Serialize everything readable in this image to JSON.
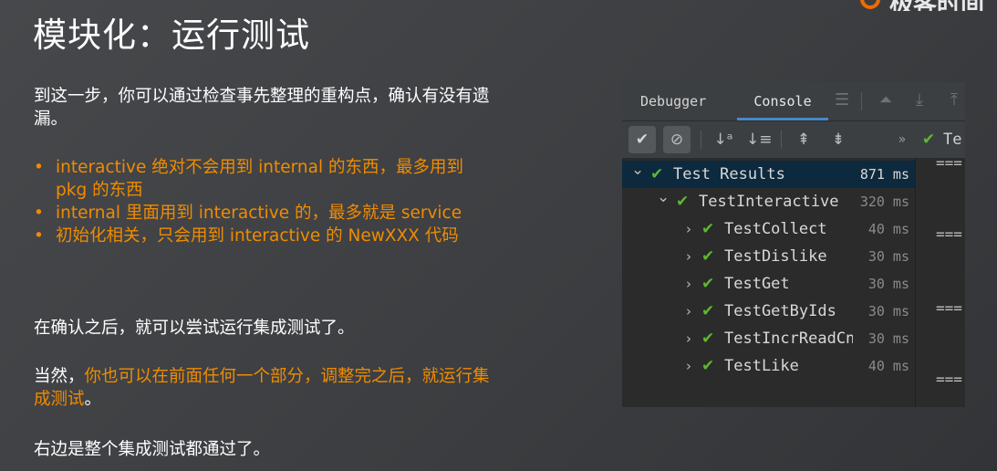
{
  "slide": {
    "title": "模块化：运行测试",
    "logo_text": "极客时间"
  },
  "content": {
    "intro": "到这一步，你可以通过检查事先整理的重构点，确认有没有遗漏。",
    "points": [
      "interactive 绝对不会用到 internal 的东西，最多用到 pkg 的东西",
      "internal 里面用到 interactive 的，最多就是 service",
      "初始化相关，只会用到 interactive 的 NewXXX 代码"
    ],
    "after_confirm": "在确认之后，就可以尝试运行集成测试了。",
    "also_prefix": "当然，",
    "also_highlight": "你也可以在前面任何一个部分，调整完之后，就运行集成测试",
    "also_suffix": "。",
    "right_side": "右边是整个集成测试都通过了。"
  },
  "ide": {
    "tabs": [
      "Debugger",
      "Console"
    ],
    "active_tab": "Console",
    "toolbar_truncated_label": "Te",
    "tree": [
      {
        "label": "Test Results",
        "time": "871 ms",
        "level": 0,
        "expanded": true,
        "selected": true
      },
      {
        "label": "TestInteractive",
        "time": "320 ms",
        "level": 1,
        "expanded": true,
        "selected": false
      },
      {
        "label": "TestCollect",
        "time": "40 ms",
        "level": 2,
        "expanded": false,
        "selected": false
      },
      {
        "label": "TestDislike",
        "time": "30 ms",
        "level": 2,
        "expanded": false,
        "selected": false
      },
      {
        "label": "TestGet",
        "time": "30 ms",
        "level": 2,
        "expanded": false,
        "selected": false
      },
      {
        "label": "TestGetByIds",
        "time": "30 ms",
        "level": 2,
        "expanded": false,
        "selected": false
      },
      {
        "label": "TestIncrReadCnt",
        "time": "30 ms",
        "level": 2,
        "expanded": false,
        "selected": false
      },
      {
        "label": "TestLike",
        "time": "40 ms",
        "level": 2,
        "expanded": false,
        "selected": false
      }
    ],
    "console_lines": [
      "===",
      "===",
      "===",
      "==="
    ],
    "colors": {
      "accent": "#f08c00",
      "pass": "#5fb832",
      "selection": "#0d293e",
      "tab_underline": "#4a88c7"
    }
  }
}
